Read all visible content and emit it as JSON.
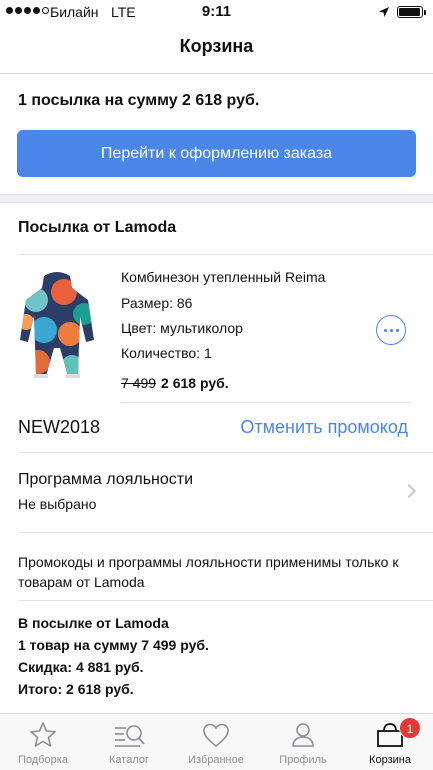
{
  "status_bar": {
    "carrier": "Билайн",
    "network": "LTE",
    "time": "9:11",
    "signal_bars": 4,
    "battery_level": 0.95
  },
  "nav": {
    "title": "Корзина"
  },
  "summary": {
    "text": "1 посылка на сумму 2 618 руб.",
    "checkout_label": "Перейти к оформлению заказа"
  },
  "parcel": {
    "title": "Посылка от Lamoda",
    "product": {
      "name": "Комбинезон утепленный Reima",
      "size": "Размер: 86",
      "color": "Цвет: мультиколор",
      "quantity": "Количество: 1",
      "old_price": "7 499",
      "new_price": "2 618 руб.",
      "image_icon": "kids-snowsuit-image",
      "more_icon": "more-dots-icon"
    },
    "promo": {
      "code": "NEW2018",
      "cancel_label": "Отменить промокод"
    },
    "loyalty": {
      "title": "Программа лояльности",
      "value": "Не выбрано"
    },
    "note": "Промокоды и программы лояльности применимы только к товарам от Lamoda",
    "totals": {
      "heading": "В посылке от Lamoda",
      "items": "1 товар на сумму 7 499 руб.",
      "discount": "Скидка: 4 881 руб.",
      "total": "Итого: 2 618 руб."
    }
  },
  "tabbar": {
    "tabs": [
      {
        "label": "Подборка",
        "icon": "star-icon"
      },
      {
        "label": "Каталог",
        "icon": "catalog-search-icon"
      },
      {
        "label": "Избранное",
        "icon": "heart-icon"
      },
      {
        "label": "Профиль",
        "icon": "profile-icon"
      },
      {
        "label": "Корзина",
        "icon": "cart-icon",
        "badge": "1",
        "active": true
      }
    ]
  },
  "colors": {
    "accent": "#4a86e8",
    "badge": "#e53935",
    "tab_inactive": "#8e8e93"
  }
}
